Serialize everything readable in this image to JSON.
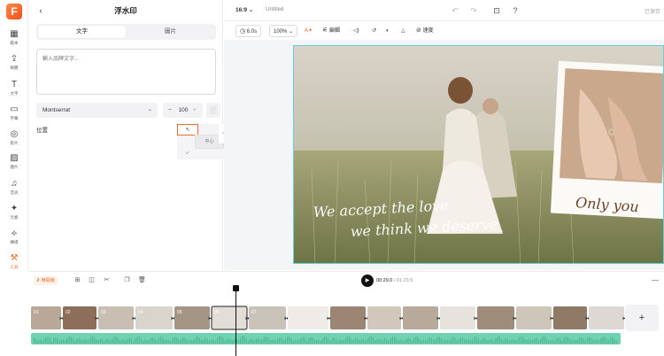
{
  "sidebar": {
    "items": [
      {
        "label": "範本",
        "icon": "template-icon"
      },
      {
        "label": "媒體",
        "icon": "upload-icon"
      },
      {
        "label": "文字",
        "icon": "text-icon"
      },
      {
        "label": "字幕",
        "icon": "subtitle-icon"
      },
      {
        "label": "影片",
        "icon": "video-icon"
      },
      {
        "label": "圖片",
        "icon": "image-icon"
      },
      {
        "label": "音訊",
        "icon": "music-icon"
      },
      {
        "label": "元素",
        "icon": "elements-icon"
      },
      {
        "label": "轉場",
        "icon": "transition-icon"
      },
      {
        "label": "工具",
        "icon": "tools-icon"
      }
    ]
  },
  "panel": {
    "title": "浮水印",
    "back_icon": "‹",
    "tabs": [
      "文字",
      "圖片"
    ],
    "text_placeholder": "輸入品牌文字...",
    "font_name": "Montserrat",
    "font_size": "100",
    "position_label": "位置",
    "position_center": "中心"
  },
  "topbar": {
    "ratio": "16:9",
    "title": "Untitled",
    "export_label": "已保存"
  },
  "toolbar": {
    "duration": "6.0s",
    "zoom": "100%",
    "edit_label": "編輯",
    "speed_label": "速度"
  },
  "canvas": {
    "line1": "We accept the love",
    "line2": "we think we deserve",
    "polaroid_text": "Only you"
  },
  "timeline": {
    "smart_label": "時間線",
    "current_time": "00:29.0",
    "total_time": "/ 01:23.5",
    "add_label": "+",
    "clip_numbers": [
      "01",
      "02",
      "03",
      "04",
      "05",
      "06",
      "07"
    ]
  },
  "colors": {
    "accent": "#f06a2b",
    "selection": "#5fd1d8",
    "audio": "#6fd3b2"
  }
}
